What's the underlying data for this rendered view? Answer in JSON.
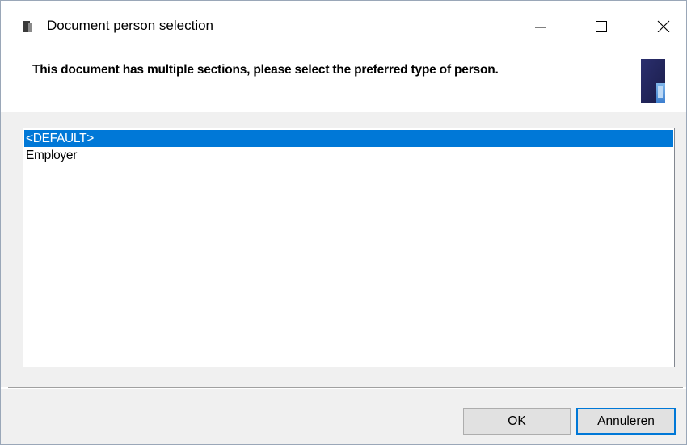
{
  "window": {
    "title": "Document person selection",
    "icons": {
      "app": "document-app-icon",
      "minimize": "minimize-icon",
      "maximize": "maximize-icon",
      "close": "close-icon"
    }
  },
  "header": {
    "message": "This document has multiple sections, please select the preferred type of person.",
    "image": "document-banner-icon"
  },
  "list": {
    "items": [
      "<DEFAULT>",
      "Employer"
    ],
    "selected_index": 0
  },
  "buttons": {
    "ok_label": "OK",
    "cancel_label": "Annuleren"
  },
  "colors": {
    "selection": "#0078d7",
    "panel": "#f0f0f0",
    "button": "#e1e1e1"
  }
}
